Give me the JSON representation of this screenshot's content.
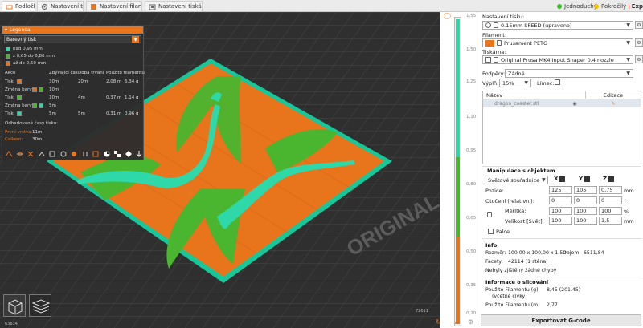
{
  "tabs": [
    {
      "label": "Podložka",
      "icon": "plater-icon"
    },
    {
      "label": "Nastavení tisku",
      "icon": "print-settings-icon"
    },
    {
      "label": "Nastavení filamentu",
      "icon": "filament-icon"
    },
    {
      "label": "Nastavení tiskárny",
      "icon": "printer-icon"
    }
  ],
  "modes": [
    {
      "label": "Jednoduchý",
      "color": "#3cbf2c"
    },
    {
      "label": "Pokročilý",
      "color": "#f2c200"
    },
    {
      "label": "Exp",
      "color": "#e0301e"
    }
  ],
  "legend": {
    "title": "Legenda",
    "view_type": "Barevný tisk",
    "ranges": [
      {
        "label": "nad 0,95 mm",
        "color": "#2fd8a8"
      },
      {
        "label": "z 0,65 do 0,80 mm",
        "color": "#4ab52f"
      },
      {
        "label": "až do 0,50 mm",
        "color": "#e8741c"
      }
    ],
    "headers": [
      "Akce",
      "Zbývající čas",
      "Doba trvání",
      "Použito filamentu"
    ],
    "rows": [
      {
        "action": "Tisk",
        "colors": [
          "#e8741c"
        ],
        "remaining": "30m",
        "duration": "20m",
        "length": "2,08 m",
        "weight": "6,34 g"
      },
      {
        "action": "Změna barvy",
        "colors": [
          "#e8741c",
          "#4ab52f"
        ],
        "remaining": "10m",
        "duration": "",
        "length": "",
        "weight": ""
      },
      {
        "action": "Tisk",
        "colors": [
          "#4ab52f"
        ],
        "remaining": "10m",
        "duration": "4m",
        "length": "0,37 m",
        "weight": "1,14 g"
      },
      {
        "action": "Změna barvy",
        "colors": [
          "#4ab52f",
          "#2fd8a8"
        ],
        "remaining": "5m",
        "duration": "",
        "length": "",
        "weight": ""
      },
      {
        "action": "Tisk",
        "colors": [
          "#2fd8a8"
        ],
        "remaining": "5m",
        "duration": "5m",
        "length": "0,31 m",
        "weight": "0,96 g"
      }
    ],
    "estimated_label": "Odhadované časy tisku:",
    "first_layer_label": "První vrstva:",
    "first_layer_value": "11m",
    "total_label": "Celkem:",
    "total_value": "30m"
  },
  "view": {
    "bed_text": "ORIGINAL",
    "coord_left": "63634",
    "coord_right": "72611",
    "slider_ticks": [
      "1,55",
      "1,50",
      "1,25",
      "1,10",
      "0,95",
      "0,80",
      "0,65",
      "0,50",
      "0,35",
      "0,20"
    ],
    "slider_colors": {
      "top": "#2fd8a8",
      "mid": "#4ab52f",
      "bottom": "#e8741c"
    }
  },
  "panel": {
    "print_settings_label": "Nastavení tisku:",
    "print_settings_value": "0.15mm SPEED (upraveno)",
    "filament_label": "Filament:",
    "filament_value": "Prusament PETG",
    "filament_color": "#e8741c",
    "printer_label": "Tiskárna:",
    "printer_value": "Original Prusa MK4 Input Shaper 0.4 nozzle",
    "supports_label": "Podpěry:",
    "supports_value": "Žádné",
    "infill_label": "Výplň:",
    "infill_value": "15%",
    "brim_label": "Límec:",
    "objects_col_name": "Název",
    "objects_col_edit": "Editace",
    "object_name": "dragon_coaster.stl",
    "manip_title": "Manipulace s objektem",
    "coord_system": "Světové souřadnice",
    "axis_x": "X",
    "axis_y": "Y",
    "axis_z": "Z",
    "position_label": "Pozice:",
    "position": [
      "125",
      "105",
      "0,75"
    ],
    "position_unit": "mm",
    "rotation_label": "Otočení (relativní):",
    "rotation": [
      "0",
      "0",
      "0"
    ],
    "rotation_unit": "°",
    "scale_label": "Měřítka:",
    "scale": [
      "100",
      "100",
      "100"
    ],
    "scale_unit": "%",
    "size_label": "Velikost [Svět]:",
    "size": [
      "100",
      "100",
      "1,5"
    ],
    "size_unit": "mm",
    "inches_label": "Palce",
    "info_title": "Info",
    "size_info_label": "Rozměr:",
    "size_info_value": "100,00 x 100,00 x 1,50",
    "volume_label": "Objem:",
    "volume_value": "6511,84",
    "facets_label": "Facety:",
    "facets_value": "42114 (1 stěna)",
    "errors_text": "Nebyly zjištěny žádné chyby",
    "slicing_title": "Informace o slicování",
    "filament_g_label": "Použito Filamentu (g)",
    "filament_g_sub": "(včetně cívky)",
    "filament_g_value": "8,45 (201,45)",
    "filament_m_label": "Použito Filamentu (m)",
    "filament_m_value": "2,77",
    "export_label": "Exportovat G-code"
  }
}
